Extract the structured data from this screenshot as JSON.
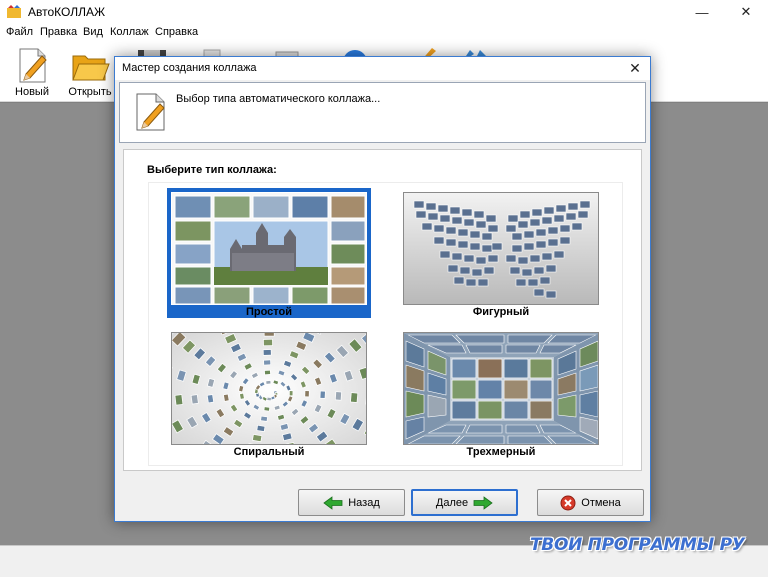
{
  "window": {
    "title": "АвтоКОЛЛАЖ",
    "minimize": "—",
    "maximize": "☐",
    "close": "✕"
  },
  "menu": [
    "Файл",
    "Правка",
    "Вид",
    "Коллаж",
    "Справка"
  ],
  "toolbar": {
    "new_label": "Новый",
    "open_label": "Открыть"
  },
  "dialog": {
    "title": "Мастер создания коллажа",
    "close": "✕",
    "header_text": "Выбор типа автоматического коллажа...",
    "prompt": "Выберите тип коллажа:",
    "options": [
      {
        "label": "Простой",
        "selected": true
      },
      {
        "label": "Фигурный",
        "selected": false
      },
      {
        "label": "Спиральный",
        "selected": false
      },
      {
        "label": "Трехмерный",
        "selected": false
      }
    ],
    "back_label": "Назад",
    "next_label": "Далее",
    "cancel_label": "Отмена"
  },
  "watermark": "ТВОИ ПРОГРАММЫ РУ",
  "colors": {
    "selection": "#1a66c9",
    "arrow_green": "#2fa830",
    "cancel_red": "#d63a2a",
    "watermark": "#3c6fd0"
  }
}
